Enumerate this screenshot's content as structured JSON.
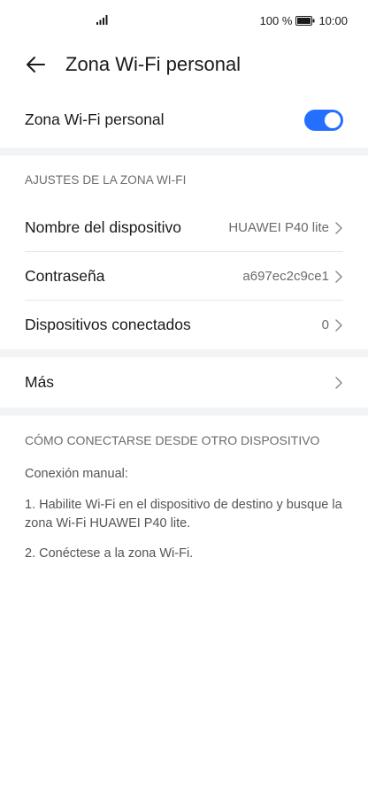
{
  "status_bar": {
    "battery_percent": "100 %",
    "time": "10:00",
    "signal_icon": "signal-icon",
    "battery_icon": "battery-icon"
  },
  "app_bar": {
    "title": "Zona Wi-Fi personal",
    "back_icon": "back-arrow-icon"
  },
  "hotspot_toggle": {
    "label": "Zona Wi-Fi personal",
    "enabled": true,
    "accent_color": "#256fff"
  },
  "settings_section": {
    "header": "AJUSTES DE LA ZONA WI-FI",
    "rows": [
      {
        "label": "Nombre del dispositivo",
        "value": "HUAWEI P40 lite"
      },
      {
        "label": "Contraseña",
        "value": "a697ec2c9ce1"
      },
      {
        "label": "Dispositivos conectados",
        "value": "0"
      }
    ]
  },
  "more_row": {
    "label": "Más"
  },
  "info_section": {
    "header": "CÓMO CONECTARSE DESDE OTRO DISPOSITIVO",
    "manual": "Conexión manual:",
    "step1": "1. Habilite Wi-Fi en el dispositivo de destino y busque la zona Wi-Fi HUAWEI P40 lite.",
    "step2": "2. Conéctese a la zona Wi-Fi."
  }
}
